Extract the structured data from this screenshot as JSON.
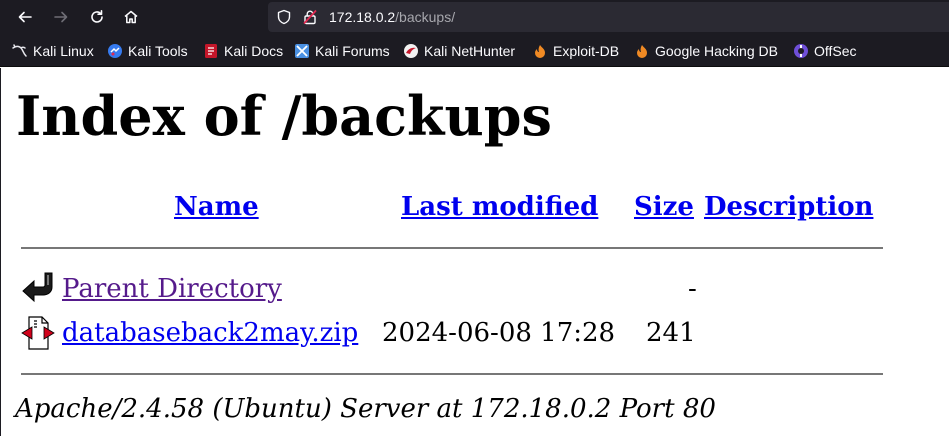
{
  "browser": {
    "nav": {
      "back_icon": "arrow-left-icon",
      "forward_icon": "arrow-right-icon",
      "reload_icon": "reload-icon",
      "home_icon": "home-icon"
    },
    "url": {
      "host": "172.18.0.2",
      "path": "/backups/"
    },
    "bookmarks": [
      {
        "label": "Kali Linux",
        "icon": "kali-dragon-icon"
      },
      {
        "label": "Kali Tools",
        "icon": "kali-tools-icon"
      },
      {
        "label": "Kali Docs",
        "icon": "kali-docs-icon"
      },
      {
        "label": "Kali Forums",
        "icon": "kali-forums-icon"
      },
      {
        "label": "Kali NetHunter",
        "icon": "nethunter-icon"
      },
      {
        "label": "Exploit-DB",
        "icon": "exploit-db-icon"
      },
      {
        "label": "Google Hacking DB",
        "icon": "ghdb-icon"
      },
      {
        "label": "OffSec",
        "icon": "offsec-icon"
      }
    ]
  },
  "page": {
    "title": "Index of /backups",
    "columns": {
      "name": "Name",
      "last_modified": "Last modified",
      "size": "Size",
      "description": "Description"
    },
    "rows": [
      {
        "name": "Parent Directory",
        "last_modified": "",
        "size": "-",
        "description": "",
        "icon": "back-arrow-icon"
      },
      {
        "name": "databaseback2may.zip",
        "last_modified": "2024-06-08 17:28",
        "size": "241",
        "description": "",
        "icon": "compressed-file-icon"
      }
    ],
    "footer": "Apache/2.4.58 (Ubuntu) Server at 172.18.0.2 Port 80"
  }
}
